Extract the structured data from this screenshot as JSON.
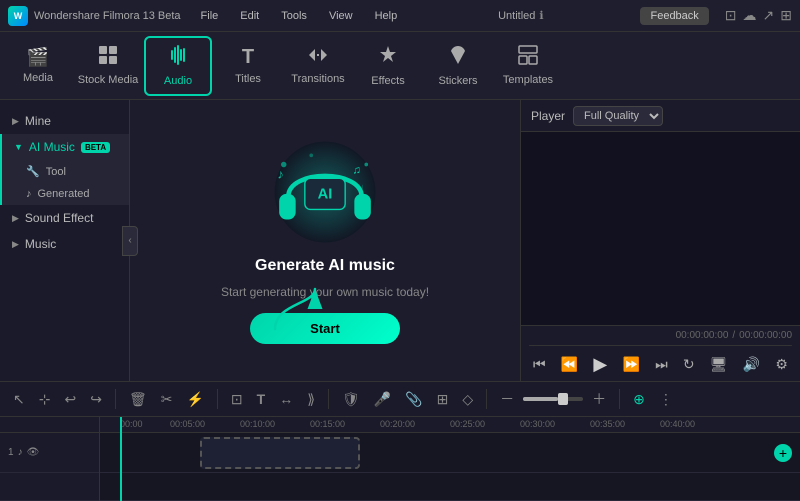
{
  "titleBar": {
    "appName": "Wondershare Filmora 13 Beta",
    "menuItems": [
      "File",
      "Edit",
      "Tools",
      "View",
      "Help"
    ],
    "docTitle": "Untitled",
    "feedbackLabel": "Feedback"
  },
  "toolbar": {
    "items": [
      {
        "id": "media",
        "label": "Media",
        "icon": "🎬"
      },
      {
        "id": "stock-media",
        "label": "Stock Media",
        "icon": "📁"
      },
      {
        "id": "audio",
        "label": "Audio",
        "icon": "♪",
        "active": true
      },
      {
        "id": "titles",
        "label": "Titles",
        "icon": "T"
      },
      {
        "id": "transitions",
        "label": "Transitions",
        "icon": "↔"
      },
      {
        "id": "effects",
        "label": "Effects",
        "icon": "✦"
      },
      {
        "id": "stickers",
        "label": "Stickers",
        "icon": "★"
      },
      {
        "id": "templates",
        "label": "Templates",
        "icon": "⊞"
      }
    ]
  },
  "sidebar": {
    "items": [
      {
        "id": "mine",
        "label": "Mine"
      },
      {
        "id": "ai-music",
        "label": "AI Music",
        "active": true,
        "beta": true
      },
      {
        "id": "tool",
        "label": "Tool"
      },
      {
        "id": "generated",
        "label": "Generated"
      },
      {
        "id": "sound-effect",
        "label": "Sound Effect"
      },
      {
        "id": "music",
        "label": "Music"
      }
    ]
  },
  "contentPanel": {
    "title": "Generate AI music",
    "subtitle": "Start generating your own music today!",
    "startButton": "Start"
  },
  "player": {
    "label": "Player",
    "quality": "Full Quality",
    "timeDisplay": "00:00:00:00",
    "timeSeparator": "/",
    "totalTime": "00:00:00:00"
  },
  "timeline": {
    "tracks": [
      {
        "id": "1",
        "label": "1"
      }
    ],
    "timeMarkers": [
      "00:00",
      "00:00:05:00",
      "00:00:10:00",
      "00:00:15:00",
      "00:00:20:00",
      "00:00:25:00",
      "00:00:30:00",
      "00:00:35:00",
      "00:00:40:00"
    ]
  }
}
